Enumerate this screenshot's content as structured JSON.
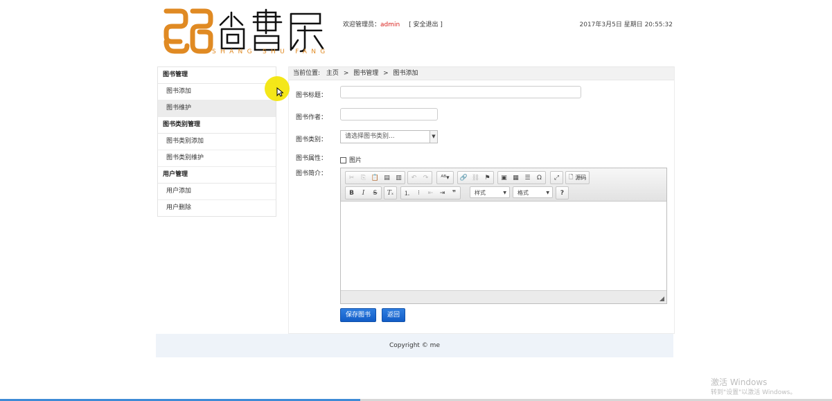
{
  "header": {
    "logo_subtitle": "SHANG SHU FANG",
    "welcome_prefix": "欢迎管理员：",
    "username": "admin",
    "logout_label": "[ 安全退出 ]",
    "datetime": "2017年3月5日 星期日 20:55:32"
  },
  "sidebar": {
    "groups": [
      {
        "title": "图书管理",
        "items": [
          "图书添加",
          "图书维护"
        ]
      },
      {
        "title": "图书类别管理",
        "items": [
          "图书类别添加",
          "图书类别维护"
        ]
      },
      {
        "title": "用户管理",
        "items": [
          "用户添加",
          "用户删除"
        ]
      }
    ],
    "active_item": "图书维护"
  },
  "breadcrumb": {
    "prefix": "当前位置:",
    "items": [
      "主页",
      "图书管理",
      "图书添加"
    ],
    "separator": ">"
  },
  "form": {
    "title_label": "图书标题：",
    "title_value": "",
    "author_label": "图书作者：",
    "author_value": "",
    "category_label": "图书类别：",
    "category_selected": "请选择图书类别...",
    "property_label": "图书属性：",
    "property_checkbox_label": "图片",
    "property_checked": false,
    "summary_label": "图书简介："
  },
  "editor": {
    "source_label": "源码",
    "styles_combo": "样式",
    "format_combo": "格式",
    "help_glyph": "?"
  },
  "buttons": {
    "save_label": "保存图书",
    "back_label": "返回"
  },
  "footer": {
    "copyright": "Copyright © me"
  },
  "watermark": {
    "line1": "激活 Windows",
    "line2": "转到\"设置\"以激活 Windows。"
  },
  "colors": {
    "logo_orange": "#e08a23",
    "username_red": "#d9211d",
    "primary_button": "#1a66d0",
    "footer_bg": "#eef3f9"
  }
}
